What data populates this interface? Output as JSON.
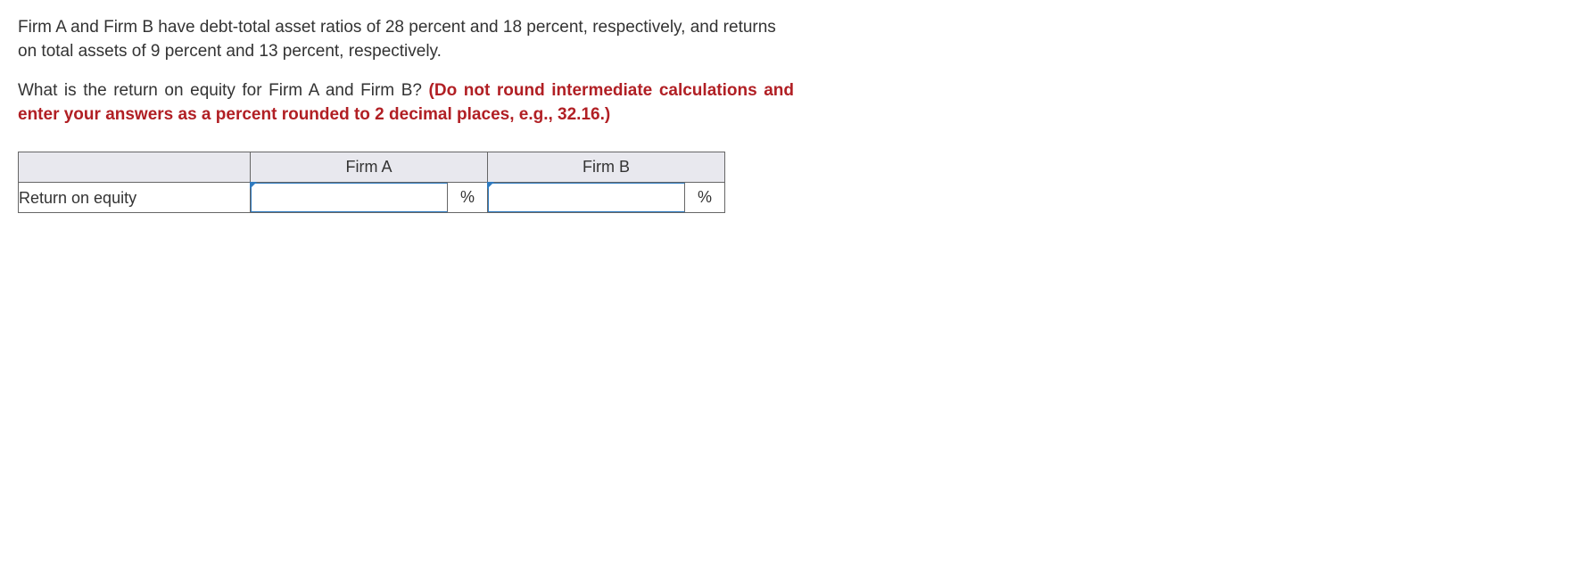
{
  "question": {
    "para1": "Firm A and Firm B have debt-total asset ratios of 28 percent and 18 percent, respectively, and returns on total assets of 9 percent and 13 percent, respectively.",
    "para2_lead": "What is the return on equity for Firm A and Firm B? ",
    "para2_instruction": "(Do not round intermediate calculations and enter your answers as a percent rounded to 2 decimal places, e.g., 32.16.)"
  },
  "table": {
    "headers": {
      "blank": "",
      "firm_a": "Firm A",
      "firm_b": "Firm B"
    },
    "row": {
      "label": "Return on equity",
      "firm_a_value": "",
      "firm_a_unit": "%",
      "firm_b_value": "",
      "firm_b_unit": "%"
    }
  }
}
